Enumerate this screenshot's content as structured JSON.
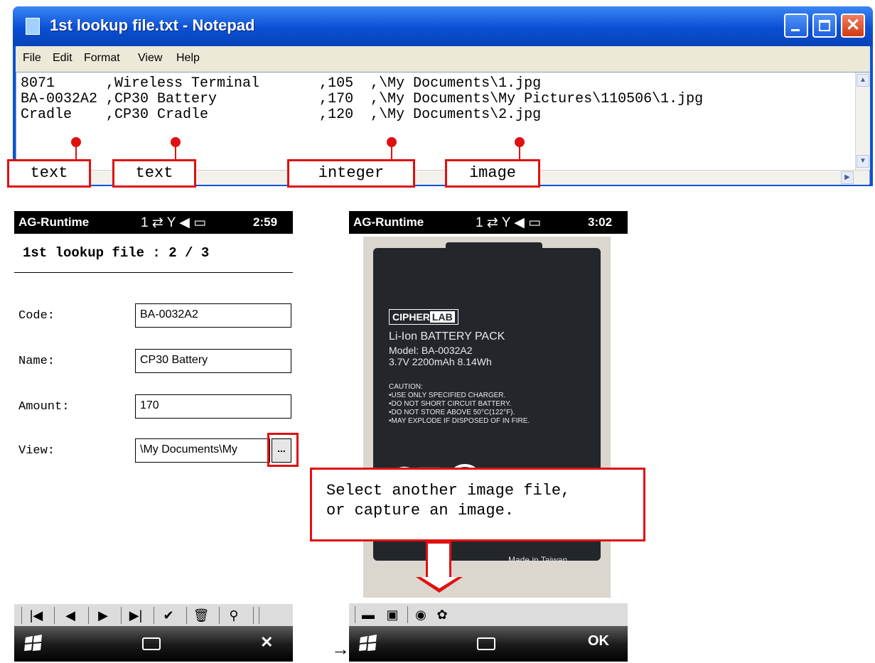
{
  "notepad": {
    "title": "1st lookup file.txt - Notepad",
    "menu": [
      "File",
      "Edit",
      "Format",
      "View",
      "Help"
    ],
    "lines": [
      "8071      ,Wireless Terminal       ,105  ,\\My Documents\\1.jpg",
      "BA-0032A2 ,CP30 Battery            ,170  ,\\My Documents\\My Pictures\\110506\\1.jpg",
      "Cradle    ,CP30 Cradle             ,120  ,\\My Documents\\2.jpg"
    ]
  },
  "field_type_labels": [
    "text",
    "text",
    "integer",
    "image"
  ],
  "phone1": {
    "app": "AG-Runtime",
    "status_icons": "1 ⇄ Y ◀ ▭",
    "time": "2:59",
    "header": "1st lookup file : 2 / 3",
    "fields": [
      {
        "label": "Code:",
        "value": "BA-0032A2"
      },
      {
        "label": "Name:",
        "value": "CP30 Battery"
      },
      {
        "label": "Amount:",
        "value": "170"
      },
      {
        "label": "View:",
        "value": "\\My Documents\\My"
      }
    ],
    "browse_label": "...",
    "toolbar": [
      "|◀",
      "◀",
      "▶",
      "▶|",
      "✔",
      "🗑",
      "⚲"
    ],
    "softkey_right": "✕"
  },
  "phone2": {
    "app": "AG-Runtime",
    "status_icons": "1 ⇄ Y ◀ ▭",
    "time": "3:02",
    "battery_photo": {
      "logo_cipher": "CIPHER",
      "logo_lab": "LAB",
      "line1": "Li-Ion BATTERY PACK",
      "line2": "Model: BA-0032A2",
      "line3": "3.7V 2200mAh 8.14Wh",
      "caution": [
        "CAUTION:",
        "•USE ONLY SPECIFIED CHARGER.",
        "•DO NOT SHORT CIRCUIT BATTERY.",
        "•DO NOT STORE ABOVE 50°C(122°F).",
        "•MAY EXPLODE IF DISPOSED OF IN FIRE."
      ],
      "ce": "CE",
      "recycle": "5",
      "made_in": "Made in Taiwan"
    },
    "toolbar": [
      "▬",
      "▣",
      "◉",
      "✿"
    ],
    "softkey_right": "OK"
  },
  "between_arrow": "→",
  "callout": {
    "line1": "Select another image file,",
    "line2": "or capture an image."
  },
  "colors": {
    "annotation_red": "#e01010",
    "xp_blue": "#0a53d6"
  }
}
